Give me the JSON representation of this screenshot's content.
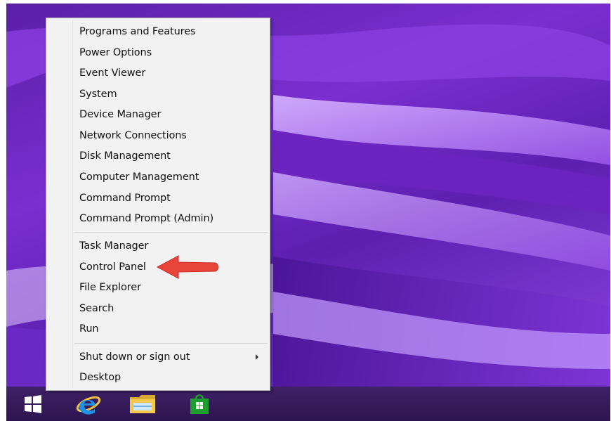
{
  "menu": {
    "groups": [
      [
        "Programs and Features",
        "Power Options",
        "Event Viewer",
        "System",
        "Device Manager",
        "Network Connections",
        "Disk Management",
        "Computer Management",
        "Command Prompt",
        "Command Prompt (Admin)"
      ],
      [
        "Task Manager",
        "Control Panel",
        "File Explorer",
        "Search",
        "Run"
      ],
      [
        "Shut down or sign out",
        "Desktop"
      ]
    ]
  },
  "taskbar": {
    "items": [
      {
        "name": "start-button-icon"
      },
      {
        "name": "internet-explorer-icon"
      },
      {
        "name": "file-explorer-icon"
      },
      {
        "name": "windows-store-icon"
      }
    ]
  },
  "colors": {
    "arrow": "#e8443a",
    "ie_blue": "#1e90e6",
    "store_green": "#1e9e2c",
    "folder_yellow": "#f2c94c"
  }
}
